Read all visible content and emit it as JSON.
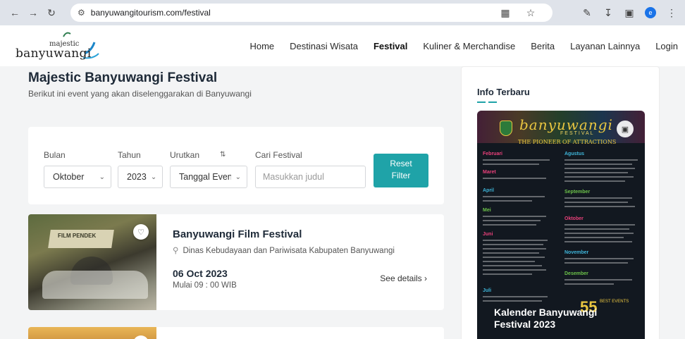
{
  "browser": {
    "url": "banyuwangitourism.com/festival",
    "profile_initial": "e"
  },
  "site": {
    "logo_top": "majestic",
    "logo_bottom": "banyuwangi",
    "nav": [
      {
        "label": "Home",
        "active": false
      },
      {
        "label": "Destinasi Wisata",
        "active": false
      },
      {
        "label": "Festival",
        "active": true
      },
      {
        "label": "Kuliner & Merchandise",
        "active": false
      },
      {
        "label": "Berita",
        "active": false
      },
      {
        "label": "Layanan Lainnya",
        "active": false
      },
      {
        "label": "Login",
        "active": false
      }
    ]
  },
  "page": {
    "title": "Majestic Banyuwangi Festival",
    "subtitle": "Berikut ini event yang akan diselenggarakan di Banyuwangi"
  },
  "filter": {
    "month_label": "Bulan",
    "month_value": "Oktober",
    "year_label": "Tahun",
    "year_value": "2023",
    "sort_label": "Urutkan",
    "sort_value": "Tanggal Event",
    "search_label": "Cari Festival",
    "search_placeholder": "Masukkan judul",
    "reset_line1": "Reset",
    "reset_line2": "Filter"
  },
  "events": [
    {
      "title": "Banyuwangi Film Festival",
      "location": "Dinas Kebudayaan dan Pariwisata Kabupaten Banyuwangi",
      "date": "06 Oct 2023",
      "time": "Mulai 09 : 00 WIB",
      "details_label": "See details",
      "image_banner": "FILM PENDEK"
    }
  ],
  "sidebar": {
    "title": "Info Terbaru",
    "poster_brand": "banyuwangi",
    "poster_fest": "FESTIVAL",
    "poster_tagline": "THE PIONEER OF ATTRACTIONS",
    "poster_months_left": [
      "Februari",
      "Maret",
      "April",
      "Mei",
      "Juni",
      "Juli"
    ],
    "poster_months_right": [
      "Agustus",
      "September",
      "Oktober",
      "November",
      "Desember"
    ],
    "poster_badge": "55",
    "poster_badge_text": "BEST EVENTS",
    "poster_caption": "Kalender Banyuwangi Festival 2023"
  },
  "colors": {
    "accent": "#1fa3a8",
    "poster_bg": "#121820",
    "poster_gold": "#e9c640",
    "month_pink": "#e9407a",
    "month_cyan": "#3fb5d9",
    "month_green": "#6cc24a"
  }
}
